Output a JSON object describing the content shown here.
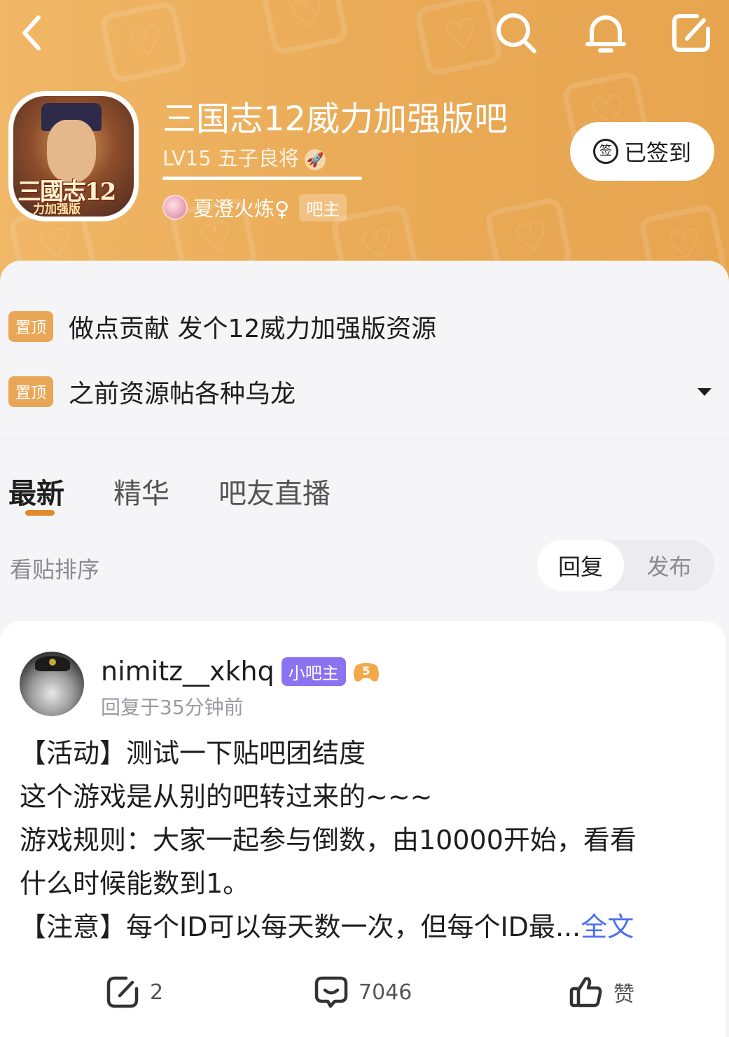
{
  "forum": {
    "title": "三国志12威力加强版吧",
    "level": "LV15 五子良将",
    "level_progress": 1.0,
    "admin_name": "夏澄火炼♀",
    "admin_tag": "吧主",
    "signed_label": "已签到",
    "signed_icon_text": "签",
    "avatar_logo": "三國志12",
    "avatar_sub": "力加强版"
  },
  "pinned": [
    {
      "tag": "置顶",
      "text": "做点贡献 发个12威力加强版资源"
    },
    {
      "tag": "置顶",
      "text": "之前资源帖各种乌龙"
    }
  ],
  "tabs": [
    {
      "label": "最新"
    },
    {
      "label": "精华"
    },
    {
      "label": "吧友直播"
    }
  ],
  "sort": {
    "label": "看贴排序",
    "options": [
      "回复",
      "发布"
    ]
  },
  "post": {
    "author": "nimitz__xkhq",
    "author_tag": "小吧主",
    "game_badge": "5",
    "time": "回复于35分钟前",
    "lines": [
      "【活动】测试一下贴吧团结度",
      "这个游戏是从别的吧转过来的~~~",
      "游戏规则：大家一起参与倒数，由10000开始，看看",
      "什么时候能数到1。",
      "【注意】每个ID可以每天数一次，但每个ID最..."
    ],
    "more_label": "全文",
    "shares": "2",
    "comments": "7046",
    "like_label": "赞"
  },
  "colors": {
    "header": "#e9a955",
    "accent": "#e08a2b",
    "mod_tag": "#8b72f0",
    "link": "#4e6ef2"
  }
}
